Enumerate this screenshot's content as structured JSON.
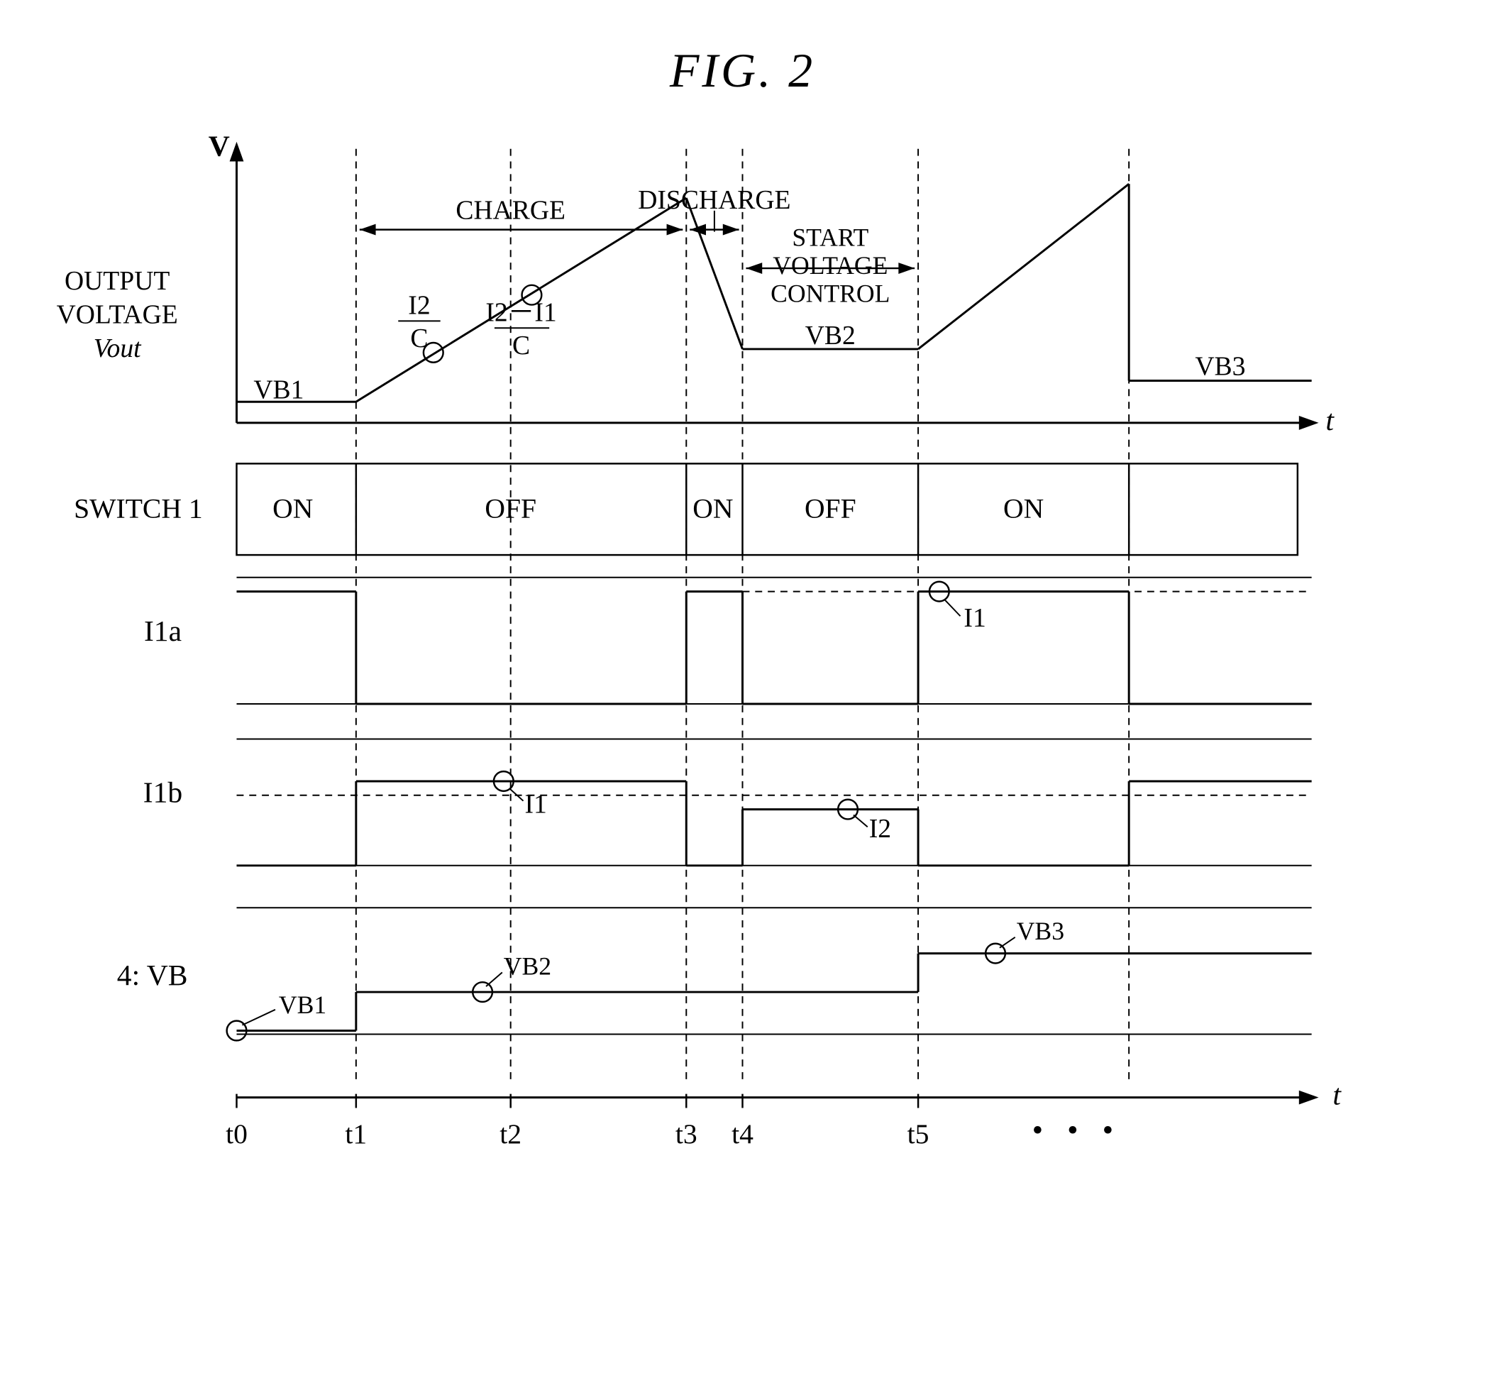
{
  "title": "FIG. 2",
  "labels": {
    "y_axis": "V",
    "t_axis": "t",
    "output_voltage": [
      "OUTPUT",
      "VOLTAGE",
      "Vout"
    ],
    "switch1": "SWITCH 1",
    "i1a": "I1a",
    "i1b": "I1b",
    "vb": "4: VB",
    "charge": "CHARGE",
    "discharge": "DISCHARGE",
    "start_voltage_control": [
      "START",
      "VOLTAGE",
      "CONTROL"
    ],
    "i2_over_c": "I2",
    "c1": "C",
    "i2_minus_i1_over_c": "I2－I1",
    "c2": "C",
    "on": "ON",
    "off": "OFF",
    "vb1_label1": "VB1",
    "vb2_label": "VB2",
    "vb3_label1": "VB3",
    "vb1_label2": "VB1",
    "vb2_label2": "VB2",
    "vb3_label2": "VB3",
    "i1_label1": "I1",
    "i1_label2": "I1",
    "i2_label": "I2",
    "t0": "t0",
    "t1": "t1",
    "t2": "t2",
    "t3": "t3",
    "t4": "t4",
    "t5": "t5",
    "dots": "・・・"
  }
}
